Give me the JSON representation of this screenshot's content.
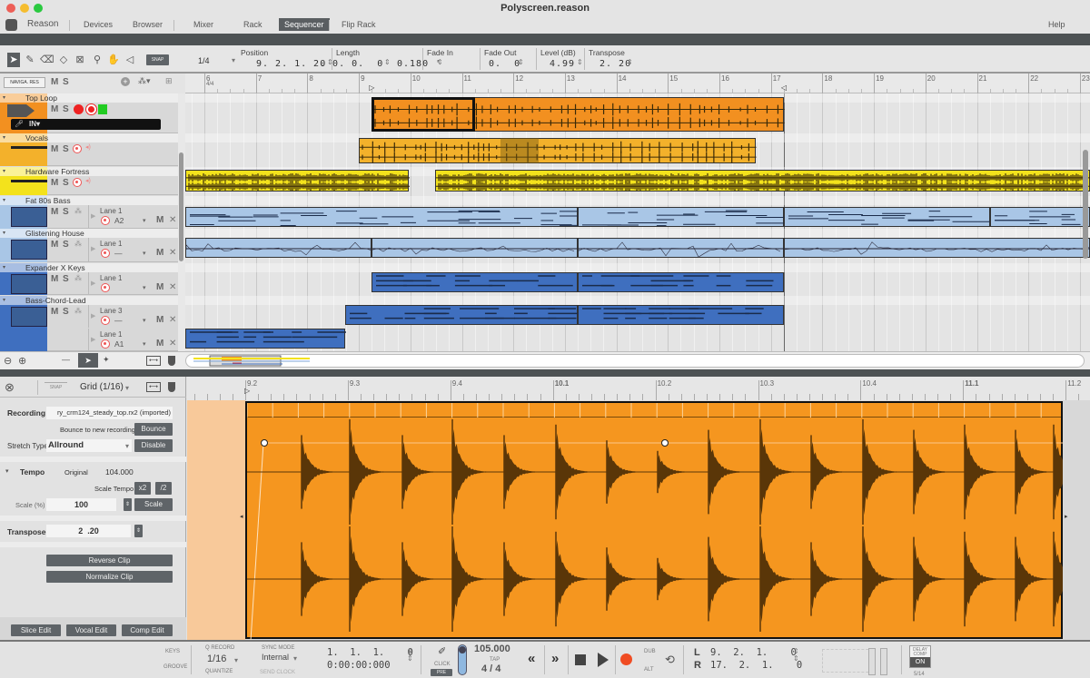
{
  "window": {
    "title": "Polyscreen.reason"
  },
  "nav": {
    "app": "Reason",
    "tabs": [
      "Devices",
      "Browser",
      "Mixer",
      "Rack",
      "Sequencer",
      "Flip Rack"
    ],
    "active_tab": "Sequencer",
    "help": "Help"
  },
  "toolbar": {
    "snap_label": "SNAP",
    "snap_value": "1/4",
    "fields": [
      {
        "label": "Position",
        "value": "9. 2. 1.  0"
      },
      {
        "label": "Length",
        "value": "2. 0. 0.  0"
      },
      {
        "label": "Fade In",
        "value": "0.180 '"
      },
      {
        "label": "Fade Out",
        "value": "0.  0"
      },
      {
        "label": "Level (dB)",
        "value": "4.99"
      },
      {
        "label": "Transpose",
        "value": "2. 20"
      }
    ]
  },
  "track_header": {
    "label": "NAVIGA. RES",
    "m": "M",
    "s": "S"
  },
  "ruler": {
    "bars": [
      "6",
      "7",
      "8",
      "9",
      "10",
      "11",
      "12",
      "13",
      "14",
      "15",
      "16",
      "17",
      "18",
      "19",
      "20",
      "21",
      "22",
      "23"
    ],
    "time_sig": "4/4"
  },
  "tracks": [
    {
      "name": "Top Loop",
      "color": "#f29020",
      "type": "audio",
      "m": "M",
      "s": "S",
      "input": "IN▾",
      "clips": [
        [
          9.25,
          17.25
        ]
      ],
      "selected": [
        9.25,
        11.25
      ]
    },
    {
      "name": "Vocals",
      "color": "#f3b12b",
      "type": "audio",
      "m": "M",
      "s": "S",
      "clips": [
        [
          9.0,
          16.7
        ]
      ]
    },
    {
      "name": "Hardware Fortress",
      "color": "#f3e21c",
      "type": "audio",
      "m": "M",
      "s": "S",
      "clips": [
        [
          5.6,
          9.97
        ],
        [
          10.48,
          23.2
        ]
      ]
    },
    {
      "name": "Fat 80s Bass",
      "color": "#a9c6e6",
      "type": "inst",
      "m": "M",
      "s": "S",
      "lanes": [
        {
          "label": "Lane 1",
          "note": "A2",
          "m": "M",
          "clips": [
            [
              5.6,
              13.25
            ],
            [
              13.25,
              17.25
            ],
            [
              17.25,
              21.25
            ],
            [
              21.25,
              23.2
            ]
          ]
        }
      ]
    },
    {
      "name": "Glistening House",
      "color": "#a9c6e6",
      "type": "inst",
      "m": "M",
      "s": "S",
      "lanes": [
        {
          "label": "Lane 1",
          "note": "—",
          "m": "M",
          "clips": [
            [
              5.6,
              9.25
            ],
            [
              9.25,
              13.25
            ],
            [
              13.25,
              17.25
            ],
            [
              17.25,
              23.2
            ]
          ]
        }
      ]
    },
    {
      "name": "Expander X Keys",
      "color": "#3f6fbf",
      "type": "inst",
      "m": "M",
      "s": "S",
      "lanes": [
        {
          "label": "Lane 1",
          "note": "",
          "m": "M",
          "clips": [
            [
              9.25,
              13.25
            ],
            [
              13.25,
              17.25
            ]
          ]
        }
      ]
    },
    {
      "name": "Bass-Chord-Lead",
      "color": "#3f6fbf",
      "type": "inst",
      "m": "M",
      "s": "S",
      "lanes": [
        {
          "label": "Lane 3",
          "note": "—",
          "m": "M",
          "clips": [
            [
              8.73,
              13.25
            ],
            [
              13.25,
              17.25
            ]
          ]
        },
        {
          "label": "Lane 1",
          "note": "A1",
          "m": "M",
          "clips": [
            [
              5.6,
              8.73
            ]
          ]
        }
      ]
    }
  ],
  "editor": {
    "snap_label": "SNAP",
    "grid": "Grid (1/16)",
    "recording_label": "Recording",
    "recording_value": "ry_crm124_steady_top.rx2 (imported)",
    "bounce_text": "Bounce to new recording",
    "bounce_btn": "Bounce",
    "stretch_label": "Stretch Type",
    "stretch_value": "Allround",
    "disable_btn": "Disable",
    "tempo_label": "Tempo",
    "original_label": "Original",
    "original_value": "104.000",
    "scale_tempo_label": "Scale Tempo",
    "x2": "x2",
    "half": "/2",
    "scale_label": "Scale (%)",
    "scale_value": "100",
    "scale_btn": "Scale",
    "transpose_label": "Transpose",
    "transpose_value": "2  .20",
    "reverse_btn": "Reverse Clip",
    "normalize_btn": "Normalize Clip",
    "tabs": [
      "Slice Edit",
      "Vocal Edit",
      "Comp Edit"
    ],
    "ruler": [
      "9.2",
      "9.3",
      "9.4",
      "10.1",
      "10.2",
      "10.3",
      "10.4",
      "11.1",
      "11.2"
    ],
    "clip_color": "#f5961f"
  },
  "transport": {
    "keys": "KEYS",
    "groove": "GROOVE",
    "q_record": "Q RECORD",
    "quantize_value": "1/16",
    "quantize": "QUANTIZE",
    "sync_mode": "SYNC MODE",
    "sync_value": "Internal",
    "send_clock": "SEND CLOCK",
    "position_bars": "1.  1.  1.    0",
    "position_time": "0:00:00:000",
    "click": "CLICK",
    "pre": "PRE",
    "tempo": "105.000",
    "tap": "TAP",
    "signature": "4 / 4",
    "dub": "DUB",
    "alt": "ALT",
    "left_label": "L",
    "left_value": "9.  2.  1.    0",
    "right_label": "R",
    "right_value": "17.  2.  1.    0",
    "delay_comp": "DELAY COMP",
    "delay_on": "ON",
    "delay_value": "5/14"
  }
}
